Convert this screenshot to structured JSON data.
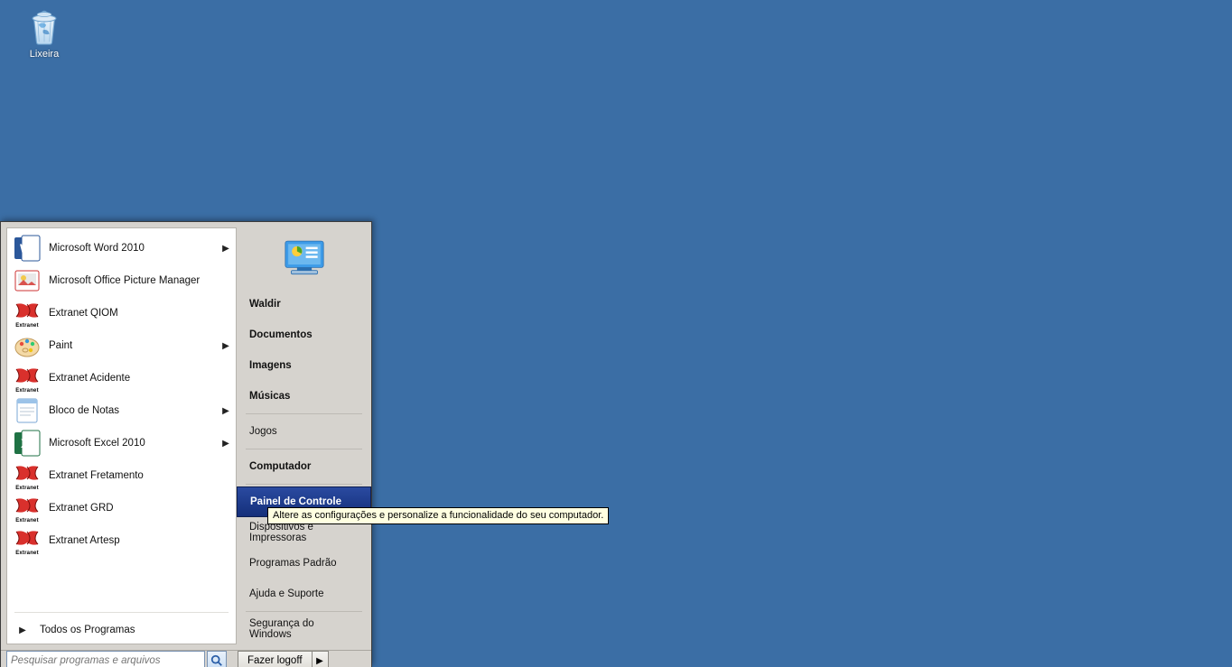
{
  "desktop": {
    "recycle_label": "Lixeira"
  },
  "start_menu": {
    "programs": [
      {
        "label": "Microsoft Word 2010",
        "icon": "word",
        "sub": true
      },
      {
        "label": "Microsoft Office Picture Manager",
        "icon": "picturemgr",
        "sub": false
      },
      {
        "label": "Extranet QIOM",
        "icon": "extranet",
        "sub": false
      },
      {
        "label": "Paint",
        "icon": "paint",
        "sub": true
      },
      {
        "label": "Extranet Acidente",
        "icon": "extranet",
        "sub": false
      },
      {
        "label": "Bloco de Notas",
        "icon": "notepad",
        "sub": true
      },
      {
        "label": "Microsoft Excel 2010",
        "icon": "excel",
        "sub": true
      },
      {
        "label": "Extranet Fretamento",
        "icon": "extranet",
        "sub": false
      },
      {
        "label": "Extranet GRD",
        "icon": "extranet",
        "sub": false
      },
      {
        "label": "Extranet Artesp",
        "icon": "extranet",
        "sub": false
      }
    ],
    "all_programs_label": "Todos os Programas",
    "right": [
      {
        "label": "Waldir",
        "bold": true
      },
      {
        "label": "Documentos",
        "bold": true
      },
      {
        "label": "Imagens",
        "bold": true
      },
      {
        "label": "Músicas",
        "bold": true
      },
      {
        "sep": true
      },
      {
        "label": "Jogos",
        "bold": false
      },
      {
        "sep": true
      },
      {
        "label": "Computador",
        "bold": true
      },
      {
        "sep": true
      },
      {
        "label": "Painel de Controle",
        "bold": true,
        "selected": true
      },
      {
        "label": "Dispositivos e Impressoras",
        "bold": false
      },
      {
        "label": "Programas Padrão",
        "bold": false
      },
      {
        "label": "Ajuda e Suporte",
        "bold": false
      },
      {
        "sep": true
      },
      {
        "label": "Segurança do Windows",
        "bold": false
      }
    ],
    "search_placeholder": "Pesquisar programas e arquivos",
    "logoff_label": "Fazer logoff",
    "tooltip": "Altere as configurações e personalize a funcionalidade do seu computador."
  },
  "icons": {
    "extranet_caption": "Extranet"
  }
}
